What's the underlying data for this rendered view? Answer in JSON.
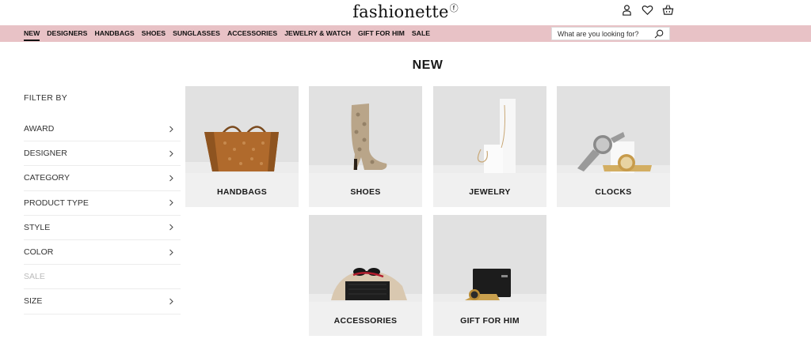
{
  "header": {
    "logo_text": "fashionette",
    "logo_mark": "ⓕ",
    "icons": [
      "user-icon",
      "heart-icon",
      "basket-icon"
    ]
  },
  "nav": {
    "items": [
      {
        "label": "NEW",
        "active": true
      },
      {
        "label": "DESIGNERS"
      },
      {
        "label": "HANDBAGS"
      },
      {
        "label": "SHOES"
      },
      {
        "label": "SUNGLASSES"
      },
      {
        "label": "ACCESSORIES"
      },
      {
        "label": "JEWELRY & WATCH"
      },
      {
        "label": "GIFT FOR HIM"
      },
      {
        "label": "SALE"
      }
    ],
    "search_placeholder": "What are you looking for?",
    "bar_color": "#e8c2c6"
  },
  "page": {
    "title": "NEW"
  },
  "filters": {
    "heading": "FILTER BY",
    "items": [
      {
        "label": "AWARD",
        "enabled": true
      },
      {
        "label": "DESIGNER",
        "enabled": true
      },
      {
        "label": "CATEGORY",
        "enabled": true
      },
      {
        "label": "PRODUCT TYPE",
        "enabled": true
      },
      {
        "label": "STYLE",
        "enabled": true
      },
      {
        "label": "COLOR",
        "enabled": true
      },
      {
        "label": "SALE",
        "enabled": false
      },
      {
        "label": "SIZE",
        "enabled": true
      }
    ]
  },
  "categories": [
    {
      "label": "HANDBAGS",
      "image": "handbag-image"
    },
    {
      "label": "SHOES",
      "image": "boot-image"
    },
    {
      "label": "JEWELRY",
      "image": "necklace-image"
    },
    {
      "label": "CLOCKS",
      "image": "watches-image"
    },
    {
      "label": "ACCESSORIES",
      "image": "accessories-image"
    },
    {
      "label": "GIFT FOR HIM",
      "image": "wallet-watch-image"
    }
  ]
}
